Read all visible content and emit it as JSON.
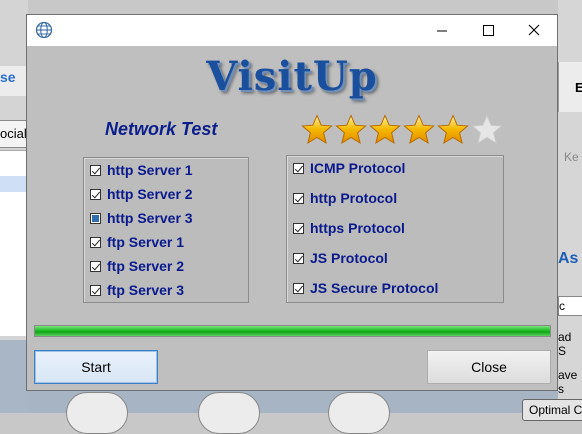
{
  "background": {
    "left_frag_text": "se",
    "left_social_text": "ocial",
    "right_top_text": "E",
    "right_ke_text": "Ke",
    "right_as_text": "As",
    "right_c_text": "c",
    "right_ad_text": "ad S",
    "right_ave_text": "ave s",
    "optimal_button": "Optimal C"
  },
  "window": {
    "icon": "globe-icon",
    "controls": {
      "minimize": "minimize-icon",
      "maximize": "maximize-icon",
      "close": "close-icon"
    }
  },
  "app": {
    "title": "VisitUp",
    "subtitle": "Network Test"
  },
  "rating": {
    "filled": 5,
    "total": 6,
    "star_color": "#f5b800",
    "empty_color": "#e6e6e6"
  },
  "servers": [
    {
      "label": "http Server 1",
      "state": "checked"
    },
    {
      "label": "http Server 2",
      "state": "checked"
    },
    {
      "label": "http Server 3",
      "state": "indeterminate"
    },
    {
      "label": "ftp Server 1",
      "state": "checked"
    },
    {
      "label": "ftp Server 2",
      "state": "checked"
    },
    {
      "label": "ftp Server 3",
      "state": "checked"
    }
  ],
  "protocols": [
    {
      "label": "ICMP Protocol",
      "state": "checked"
    },
    {
      "label": "http Protocol",
      "state": "checked"
    },
    {
      "label": "https Protocol",
      "state": "checked"
    },
    {
      "label": "JS Protocol",
      "state": "checked"
    },
    {
      "label": "JS Secure Protocol",
      "state": "checked"
    }
  ],
  "progress": {
    "value": 1.0,
    "color": "#1fbe27"
  },
  "buttons": {
    "start": "Start",
    "close": "Close"
  }
}
